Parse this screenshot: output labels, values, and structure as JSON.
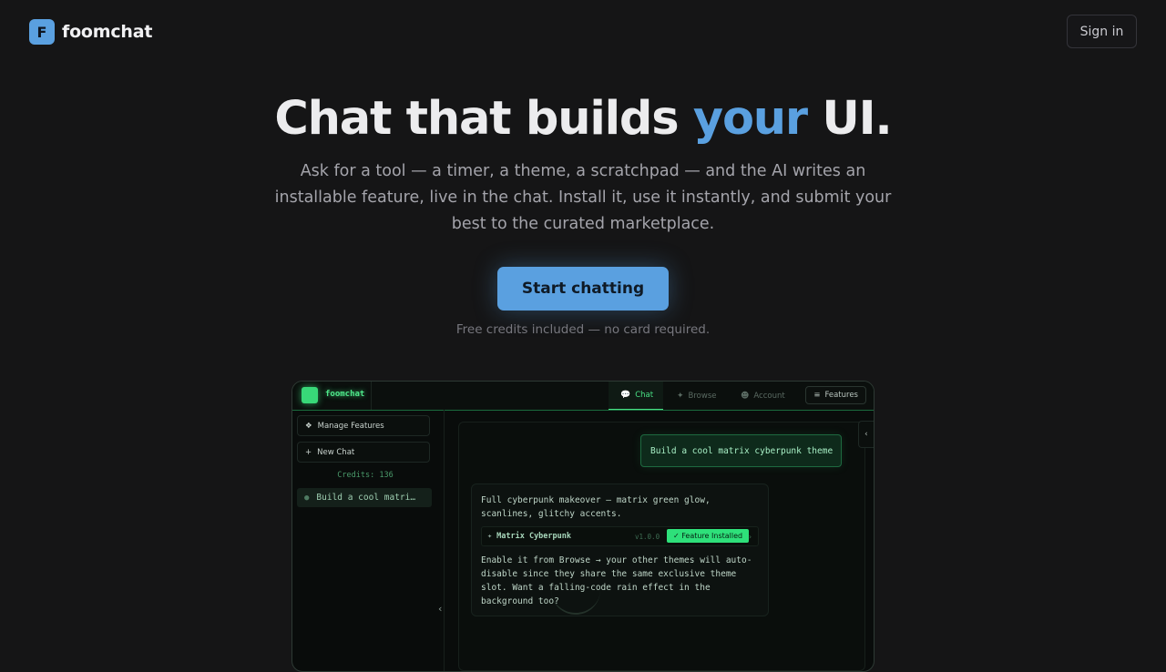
{
  "header": {
    "logo_letter": "F",
    "brand": "foomchat",
    "signin_label": "Sign in"
  },
  "hero": {
    "title_pre": "Chat that builds ",
    "title_accent": "your",
    "title_post": " UI.",
    "subtitle": "Ask for a tool — a timer, a theme, a scratchpad — and the AI writes an installable feature, live in the chat. Install it, use it instantly, and submit your best to the curated marketplace.",
    "cta_label": "Start chatting",
    "cta_note": "Free credits included — no card required."
  },
  "colors": {
    "accent": "#5aa0e0",
    "background": "#151516",
    "preview_green": "#48e084"
  },
  "preview": {
    "brand": "foomchat",
    "tabs": [
      {
        "label": "Chat",
        "icon": "chat-bubbles-icon",
        "active": true
      },
      {
        "label": "Browse",
        "icon": "puzzle-icon",
        "active": false
      },
      {
        "label": "Account",
        "icon": "user-icon",
        "active": false
      }
    ],
    "features_label": "Features",
    "sidebar": {
      "manage_label": "Manage Features",
      "new_chat_label": "New Chat",
      "credits": "Credits: 136",
      "chat_item": "Build a cool matri…"
    },
    "user_message": "Build a cool matrix cyberpunk theme",
    "ai_message_intro": "Full cyberpunk makeover — matrix green glow, scanlines, glitchy accents.",
    "feature": {
      "name": "Matrix Cyberpunk",
      "version": "v1.0.0",
      "badge": "✓ Feature Installed",
      "more": "›"
    },
    "ai_message_outro": "Enable it from Browse → your other themes will auto-disable since they share the same exclusive theme slot. Want a falling-code rain effect in the background too?"
  }
}
